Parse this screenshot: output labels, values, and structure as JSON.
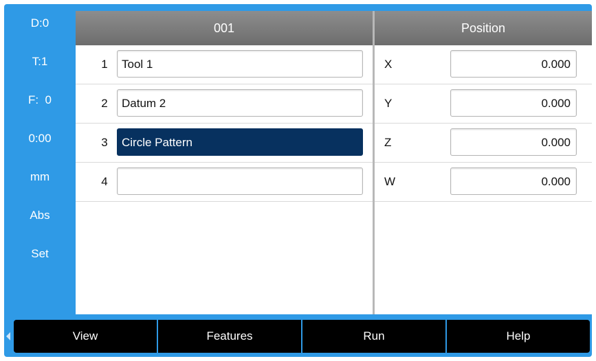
{
  "sidebar": {
    "items": [
      {
        "label": "D:0"
      },
      {
        "label": "T:1"
      },
      {
        "label": "F:  0"
      },
      {
        "label": "0:00"
      },
      {
        "label": "mm"
      },
      {
        "label": "Abs"
      },
      {
        "label": "Set"
      }
    ]
  },
  "program": {
    "title": "001",
    "rows": [
      {
        "num": "1",
        "text": "Tool 1"
      },
      {
        "num": "2",
        "text": "Datum 2"
      },
      {
        "num": "3",
        "text": "Circle Pattern",
        "selected": true
      },
      {
        "num": "4",
        "text": ""
      }
    ]
  },
  "position": {
    "title": "Position",
    "axes": [
      {
        "axis": "X",
        "value": "0.000"
      },
      {
        "axis": "Y",
        "value": "0.000"
      },
      {
        "axis": "Z",
        "value": "0.000"
      },
      {
        "axis": "W",
        "value": "0.000"
      }
    ]
  },
  "softkeys": {
    "view": "View",
    "features": "Features",
    "run": "Run",
    "help": "Help"
  },
  "colors": {
    "frame_blue": "#2f9ae6",
    "selected_row": "#07315f",
    "header_gray": "#7d7d7d"
  },
  "icons": {
    "left_arrow": "chevron-left-icon"
  }
}
